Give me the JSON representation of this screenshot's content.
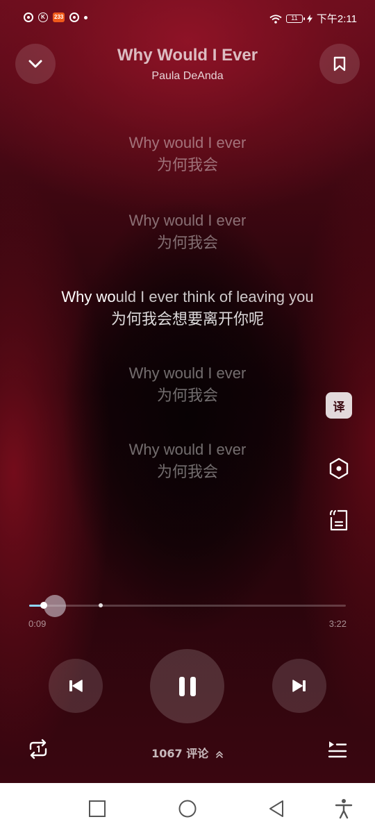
{
  "status_bar": {
    "badge_text": "233",
    "k_label": "K",
    "battery": "11",
    "time": "下午2:11"
  },
  "song": {
    "title": "Why Would I Ever",
    "artist": "Paula DeAnda"
  },
  "lyrics": [
    {
      "en": "Why would I ever",
      "zh": "为何我会",
      "current": false
    },
    {
      "en": "Why would I ever",
      "zh": "为何我会",
      "current": false
    },
    {
      "en_highlight": "Why wo",
      "en_rest": "uld I ever think of leaving you",
      "zh": "为何我会想要离开你呢",
      "current": true
    },
    {
      "en": "Why would I ever",
      "zh": "为何我会",
      "current": false
    },
    {
      "en": "Why would I ever",
      "zh": "为何我会",
      "current": false
    }
  ],
  "side_actions": {
    "translate_label": "译"
  },
  "progress": {
    "elapsed": "0:09",
    "total": "3:22",
    "fraction": 0.045,
    "marker_fraction": 0.226
  },
  "comments": {
    "count_label": "1067 评论"
  },
  "icons": {
    "collapse": "chevron-down-icon",
    "bookmark": "bookmark-icon",
    "translate": "translate-icon",
    "hexagon": "sound-effect-icon",
    "lyrics_doc": "lyrics-poster-icon",
    "previous": "previous-icon",
    "pause": "pause-icon",
    "next": "next-icon",
    "repeat": "repeat-one-icon",
    "playlist": "playlist-icon",
    "nav_recent": "square-icon",
    "nav_home": "circle-icon",
    "nav_back": "triangle-back-icon",
    "nav_accessibility": "accessibility-icon"
  },
  "colors": {
    "accent_progress": "#8fd6ff",
    "background_red": "#6a0d1e"
  }
}
